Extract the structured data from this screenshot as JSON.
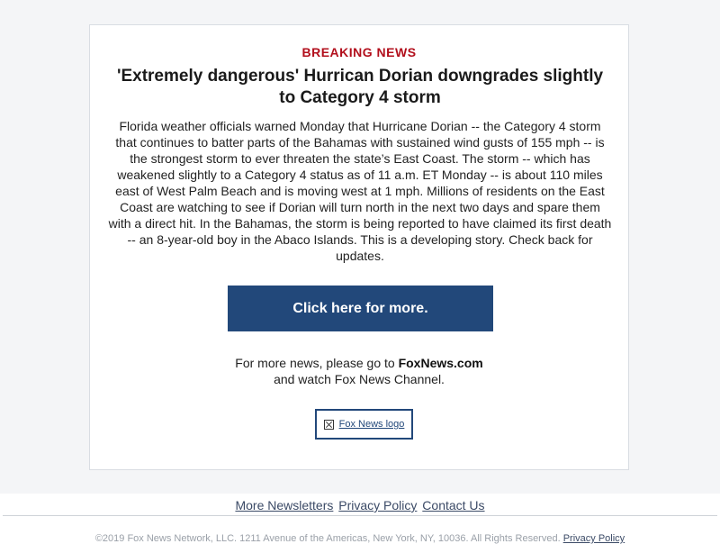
{
  "email": {
    "kicker": "BREAKING NEWS",
    "headline": "'Extremely dangerous' Hurrican Dorian downgrades slightly to Category 4 storm",
    "story": "Florida weather officials warned Monday that Hurricane Dorian -- the Category 4 storm that continues to batter parts of the Bahamas with sustained wind gusts of 155 mph -- is the strongest storm to ever threaten the state’s East Coast. The storm -- which has weakened slightly to a Category 4 status as of 11 a.m. ET Monday -- is about 110 miles east of West Palm Beach and is moving west at 1 mph. Millions of residents on the East Coast are watching to see if Dorian will turn north in the next two days and spare them with a direct hit. In the Bahamas, the storm is being reported to have claimed its first death -- an 8-year-old boy in the Abaco Islands. This is a developing story. Check back for updates.",
    "cta_label": "Click here for more.",
    "more_news_prefix": "For more news, please go to ",
    "more_news_link": "FoxNews.com",
    "more_news_suffix": "and watch Fox News Channel.",
    "logo_alt": "Fox News logo",
    "logo_icon": "broken-image-icon"
  },
  "footer": {
    "links": [
      "More Newsletters",
      "Privacy Policy",
      "Contact Us"
    ],
    "legal_text": "©2019 Fox News Network, LLC. 1211 Avenue of the Americas, New York, NY, 10036. All Rights Reserved.",
    "legal_link": "Privacy Policy"
  },
  "colors": {
    "kicker": "#b20f1c",
    "cta_bg": "#22487a",
    "page_bg": "#f4f5f7"
  }
}
